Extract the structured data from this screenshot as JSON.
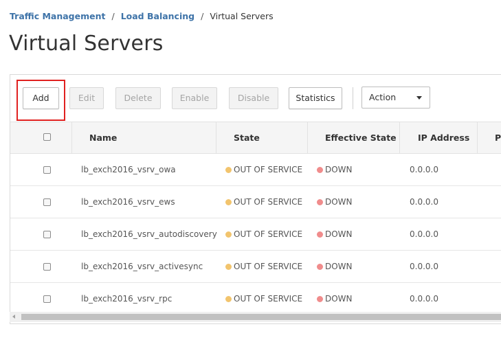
{
  "breadcrumb": {
    "items": [
      "Traffic Management",
      "Load Balancing"
    ],
    "current": "Virtual Servers",
    "separator": "/"
  },
  "page": {
    "title": "Virtual Servers"
  },
  "toolbar": {
    "add_label": "Add",
    "edit_label": "Edit",
    "delete_label": "Delete",
    "enable_label": "Enable",
    "disable_label": "Disable",
    "statistics_label": "Statistics",
    "action_label": "Action"
  },
  "table": {
    "columns": [
      "Name",
      "State",
      "Effective State",
      "IP Address",
      "Po"
    ],
    "rows": [
      {
        "name": "lb_exch2016_vsrv_owa",
        "state": "OUT OF SERVICE",
        "effective_state": "DOWN",
        "ip": "0.0.0.0"
      },
      {
        "name": "lb_exch2016_vsrv_ews",
        "state": "OUT OF SERVICE",
        "effective_state": "DOWN",
        "ip": "0.0.0.0"
      },
      {
        "name": "lb_exch2016_vsrv_autodiscovery",
        "state": "OUT OF SERVICE",
        "effective_state": "DOWN",
        "ip": "0.0.0.0"
      },
      {
        "name": "lb_exch2016_vsrv_activesync",
        "state": "OUT OF SERVICE",
        "effective_state": "DOWN",
        "ip": "0.0.0.0"
      },
      {
        "name": "lb_exch2016_vsrv_rpc",
        "state": "OUT OF SERVICE",
        "effective_state": "DOWN",
        "ip": "0.0.0.0"
      }
    ]
  },
  "colors": {
    "link": "#3e73a8",
    "highlight": "#e0201f",
    "out_of_service": "#f2c46d",
    "down": "#f08c8c"
  }
}
